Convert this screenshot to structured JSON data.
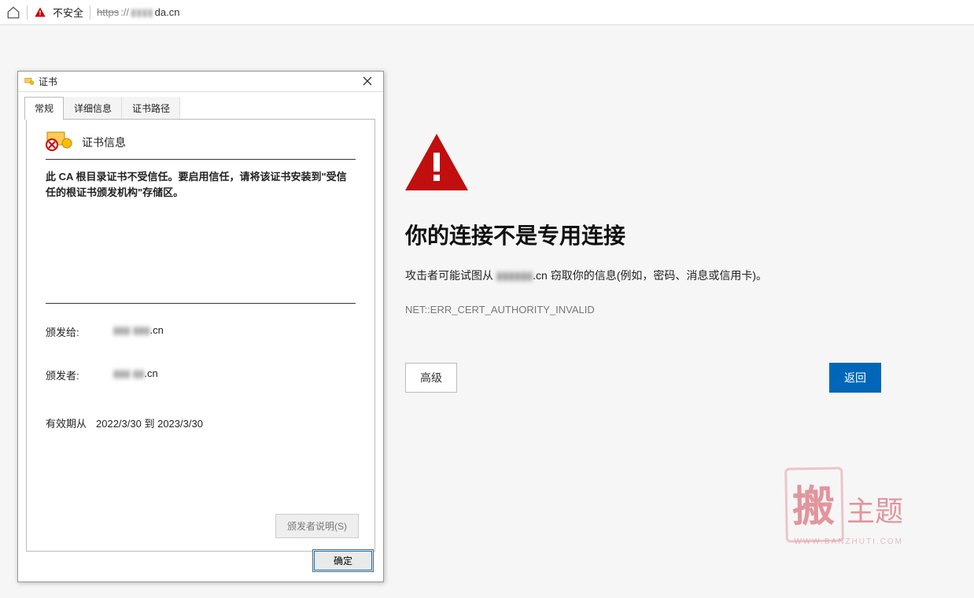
{
  "addressbar": {
    "security_label": "不安全",
    "url_https": "https",
    "url_slash": "://",
    "url_blur": "▮▮▮▮",
    "url_rest": "da.cn"
  },
  "error_page": {
    "title": "你的连接不是专用连接",
    "desc_pre": "攻击者可能试图从 ",
    "desc_blur": "▮▮▮▮▮▮",
    "desc_mid": ".cn 窃取你的信息(例如，密码、消息或信用卡)。",
    "error_code": "NET::ERR_CERT_AUTHORITY_INVALID",
    "advanced_btn": "高级",
    "back_btn": "返回"
  },
  "cert_dialog": {
    "title": "证书",
    "tabs": {
      "general": "常规",
      "details": "详细信息",
      "path": "证书路径"
    },
    "info_heading": "证书信息",
    "warning_msg": "此 CA 根目录证书不受信任。要启用信任，请将该证书安装到\"受信任的根证书颁发机构\"存储区。",
    "issued_to_label": "颁发给:",
    "issued_to_blur": "▮▮▮ ▮▮▮",
    "issued_to_suffix": ".cn",
    "issued_by_label": "颁发者:",
    "issued_by_blur": "▮▮▮ ▮▮",
    "issued_by_suffix": ".cn",
    "valid_label": "有效期从",
    "valid_from": "2022/3/30",
    "valid_sep": " 到 ",
    "valid_to": "2023/3/30",
    "issuer_statement_btn": "颁发者说明(S)",
    "ok_btn": "确定"
  },
  "watermark": {
    "big": "搬",
    "mid": "主题",
    "small": "WWW.BANZHUTI.COM"
  }
}
